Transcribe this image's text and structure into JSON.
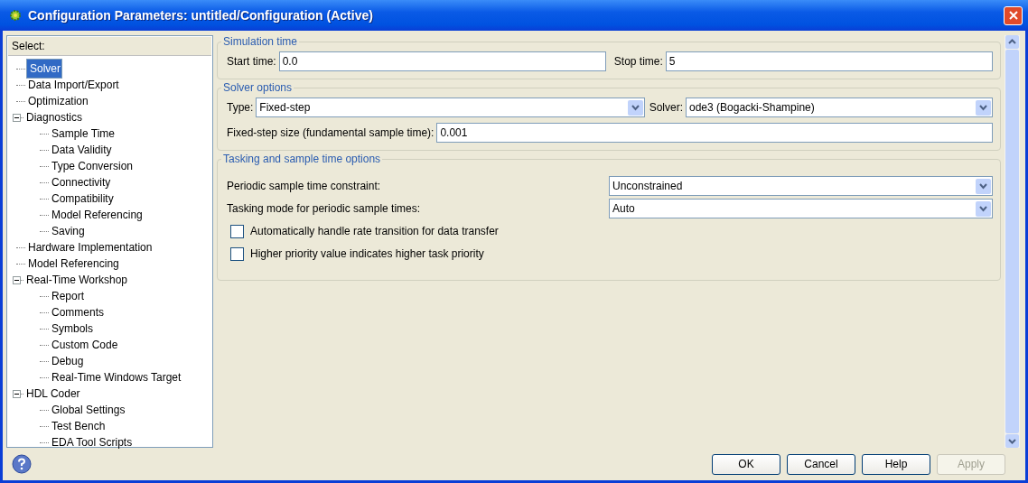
{
  "window": {
    "title": "Configuration Parameters: untitled/Configuration (Active)"
  },
  "tree": {
    "header": "Select:",
    "items": [
      {
        "label": "Solver",
        "selected": true
      },
      {
        "label": "Data Import/Export",
        "selected": false
      },
      {
        "label": "Optimization",
        "selected": false
      },
      {
        "label": "Diagnostics",
        "selected": false,
        "expanded": true,
        "children": [
          {
            "label": "Sample Time",
            "selected": false
          },
          {
            "label": "Data Validity",
            "selected": false
          },
          {
            "label": "Type Conversion",
            "selected": false
          },
          {
            "label": "Connectivity",
            "selected": false
          },
          {
            "label": "Compatibility",
            "selected": false
          },
          {
            "label": "Model Referencing",
            "selected": false
          },
          {
            "label": "Saving",
            "selected": false
          }
        ]
      },
      {
        "label": "Hardware Implementation",
        "selected": false
      },
      {
        "label": "Model Referencing",
        "selected": false
      },
      {
        "label": "Real-Time Workshop",
        "selected": false,
        "expanded": true,
        "children": [
          {
            "label": "Report",
            "selected": false
          },
          {
            "label": "Comments",
            "selected": false
          },
          {
            "label": "Symbols",
            "selected": false
          },
          {
            "label": "Custom Code",
            "selected": false
          },
          {
            "label": "Debug",
            "selected": false
          },
          {
            "label": "Real-Time Windows Target",
            "selected": false
          }
        ]
      },
      {
        "label": "HDL Coder",
        "selected": false,
        "expanded": true,
        "children": [
          {
            "label": "Global Settings",
            "selected": false
          },
          {
            "label": "Test Bench",
            "selected": false
          },
          {
            "label": "EDA Tool Scripts",
            "selected": false
          }
        ]
      }
    ]
  },
  "simulation_time": {
    "title": "Simulation time",
    "start_label": "Start time:",
    "start_value": "0.0",
    "stop_label": "Stop time:",
    "stop_value": "5"
  },
  "solver_options": {
    "title": "Solver options",
    "type_label": "Type:",
    "type_value": "Fixed-step",
    "solver_label": "Solver:",
    "solver_value": "ode3 (Bogacki-Shampine)",
    "step_label": "Fixed-step size (fundamental sample time):",
    "step_value": "0.001"
  },
  "tasking": {
    "title": "Tasking and sample time options",
    "rows": [
      {
        "kind": "select",
        "label": "Periodic sample time constraint:",
        "value": "Unconstrained"
      },
      {
        "kind": "select",
        "label": "Tasking mode for periodic sample times:",
        "value": "Auto"
      },
      {
        "kind": "checkbox",
        "label": "Automatically handle rate transition for data transfer",
        "checked": false
      },
      {
        "kind": "checkbox",
        "label": "Higher priority value indicates higher task priority",
        "checked": false
      }
    ]
  },
  "buttons": [
    {
      "label": "OK",
      "disabled": false
    },
    {
      "label": "Cancel",
      "disabled": false
    },
    {
      "label": "Help",
      "disabled": false
    },
    {
      "label": "Apply",
      "disabled": true
    }
  ]
}
